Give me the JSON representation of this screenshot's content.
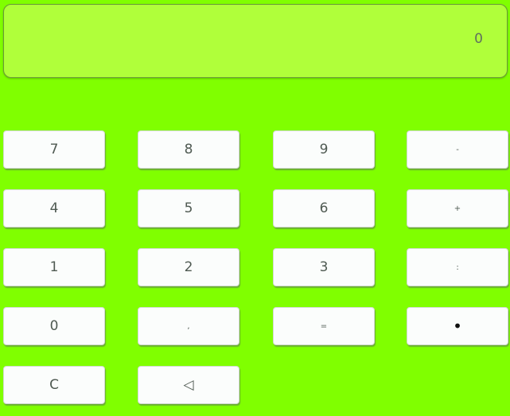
{
  "display": {
    "value": "0"
  },
  "keys": {
    "k7": "7",
    "k8": "8",
    "k9": "9",
    "minus": "-",
    "k4": "4",
    "k5": "5",
    "k6": "6",
    "plus": "+",
    "k1": "1",
    "k2": "2",
    "k3": "3",
    "divide": ":",
    "k0": "0",
    "comma": ",",
    "equals": "=",
    "multiply": "•",
    "clear": "C",
    "backspace": "◁"
  }
}
